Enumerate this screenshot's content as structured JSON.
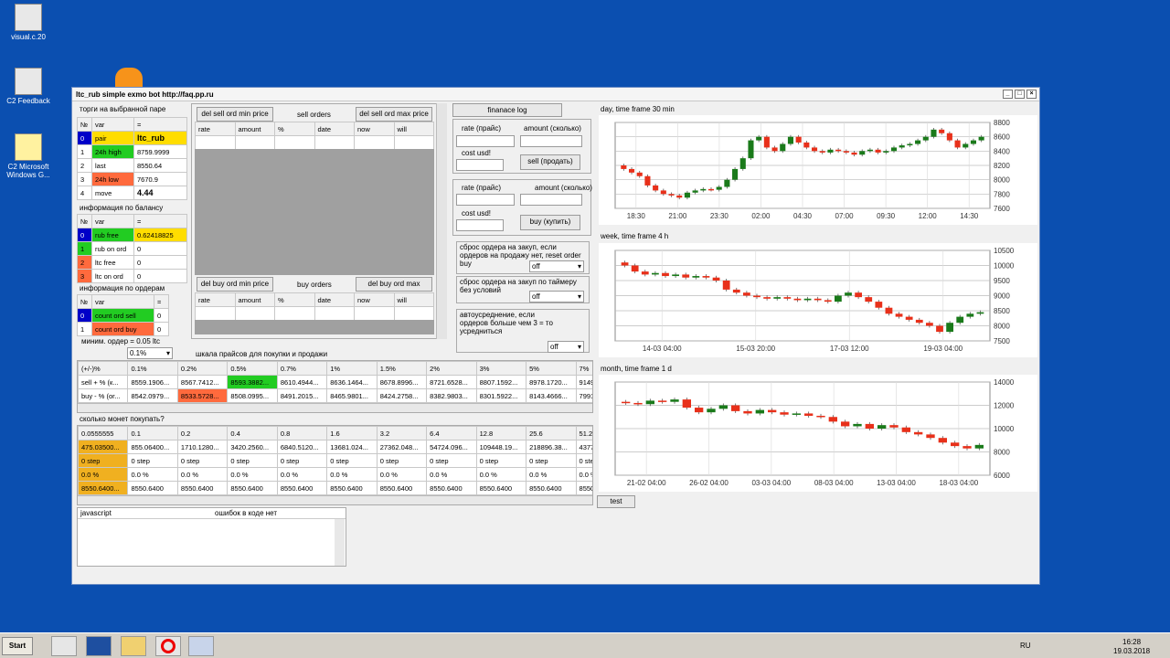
{
  "desktop": {
    "icons": [
      {
        "label": "visual.c.20"
      },
      {
        "label": "C2 Feedback"
      },
      {
        "label": "C2 Microsoft Windows G..."
      }
    ]
  },
  "window": {
    "title": "ltc_rub simple exmo bot http://faq.pp.ru",
    "controls": [
      "_",
      "□",
      "×"
    ]
  },
  "pair_section": {
    "title": "торги на выбранной паре",
    "headers": [
      "№",
      "var",
      "="
    ],
    "rows": [
      {
        "n": "0",
        "var": "pair",
        "val": "ltc_rub"
      },
      {
        "n": "1",
        "var": "24h high",
        "val": "8759.9999"
      },
      {
        "n": "2",
        "var": "last",
        "val": "8550.64"
      },
      {
        "n": "3",
        "var": "24h low",
        "val": "7670.9"
      },
      {
        "n": "4",
        "var": "move",
        "val": "4.44"
      }
    ]
  },
  "balance_section": {
    "title": "информация по балансу",
    "headers": [
      "№",
      "var",
      "="
    ],
    "rows": [
      {
        "n": "0",
        "var": "rub free",
        "val": "0.62418825"
      },
      {
        "n": "1",
        "var": "rub on ord",
        "val": "0"
      },
      {
        "n": "2",
        "var": "ltc free",
        "val": "0"
      },
      {
        "n": "3",
        "var": "ltc on ord",
        "val": "0"
      }
    ]
  },
  "orders_section": {
    "title": "информация по ордерам",
    "headers": [
      "№",
      "var",
      "="
    ],
    "rows": [
      {
        "n": "0",
        "var": "count ord sell",
        "val": "0"
      },
      {
        "n": "1",
        "var": "count ord buy",
        "val": "0"
      }
    ]
  },
  "min_order": {
    "label": "миним. ордер = 0.05 ltc",
    "value": "0.1%"
  },
  "sell_orders": {
    "btn_min": "del sell ord min price",
    "title": "sell orders",
    "btn_max": "del sell ord max price",
    "headers": [
      "rate",
      "amount",
      "%",
      "date",
      "now",
      "will"
    ]
  },
  "buy_orders": {
    "btn_min": "del buy ord min price",
    "title": "buy orders",
    "btn_max": "del buy ord max",
    "headers": [
      "rate",
      "amount",
      "%",
      "date",
      "now",
      "will"
    ]
  },
  "right_controls": {
    "finance_log": "finanace log",
    "sell_rate_label": "rate (прайс)",
    "sell_amount_label": "amount (сколько)",
    "sell_cost_label": "cost usd!",
    "sell_button": "sell (продать)",
    "buy_rate_label": "rate (прайс)",
    "buy_amount_label": "amount (сколько)",
    "buy_cost_label": "cost usd!",
    "buy_button": "buy (купить)",
    "reset_label": "сброс ордера на закуп, если ордеров на продажу нет, reset order buy",
    "reset_value": "off",
    "timer_label": "сброс ордера на закуп по таймеру без условий",
    "timer_value": "off",
    "avg_label": "автоусреднение, если ордеров больше чем 3 = то усредниться",
    "avg_value": "off"
  },
  "price_scale": {
    "title": "шкала прайсов для покупки и продажи",
    "headers": [
      "(+/-)%",
      "0.1%",
      "0.2%",
      "0.5%",
      "0.7%",
      "1%",
      "1.5%",
      "2%",
      "3%",
      "5%",
      "7%"
    ],
    "rows": [
      [
        "sell + % (к...",
        "8559.1906...",
        "8567.7412...",
        "8593.3882...",
        "8610.4944...",
        "8636.1464...",
        "8678.8996...",
        "8721.6528...",
        "8807.1592...",
        "8978.1720...",
        "9149..."
      ],
      [
        "buy - % (or...",
        "8542.0979...",
        "8533.5728...",
        "8508.0995...",
        "8491.2015...",
        "8465.9801...",
        "8424.2758...",
        "8382.9803...",
        "8301.5922...",
        "8143.4666...",
        "7991.2..."
      ]
    ]
  },
  "coins_table": {
    "title": "сколько монет покупать?",
    "headers": [
      "0.0555555",
      "0.1",
      "0.2",
      "0.4",
      "0.8",
      "1.6",
      "3.2",
      "6.4",
      "12.8",
      "25.6",
      "51.2"
    ],
    "rows": [
      [
        "475.03500...",
        "855.06400...",
        "1710.1280...",
        "3420.2560...",
        "6840.5120...",
        "13681.024...",
        "27362.048...",
        "54724.096...",
        "109448.19...",
        "218896.38...",
        "43779..."
      ],
      [
        "0 step",
        "0 step",
        "0 step",
        "0 step",
        "0 step",
        "0 step",
        "0 step",
        "0 step",
        "0 step",
        "0 step",
        "0 step"
      ],
      [
        "0.0 %",
        "0.0 %",
        "0.0 %",
        "0.0 %",
        "0.0 %",
        "0.0 %",
        "0.0 %",
        "0.0 %",
        "0.0 %",
        "0.0 %",
        "0.0 %"
      ],
      [
        "8550.6400...",
        "8550.6400",
        "8550.6400",
        "8550.6400",
        "8550.6400",
        "8550.6400",
        "8550.6400",
        "8550.6400",
        "8550.6400",
        "8550.6400",
        "8550.6..."
      ]
    ]
  },
  "js_panel": {
    "tab1": "javascript",
    "tab2": "ошибок в коде нет"
  },
  "test_button": "test",
  "chart_data": [
    {
      "type": "candlestick",
      "title": "day, time frame 30 min",
      "x_ticks": [
        "18:30",
        "21:00",
        "23:30",
        "02:00",
        "04:30",
        "07:00",
        "09:30",
        "12:00",
        "14:30"
      ],
      "y_ticks": [
        7600,
        7800,
        8000,
        8200,
        8400,
        8600,
        8800
      ],
      "ylim": [
        7600,
        8800
      ],
      "close": [
        8150,
        8100,
        8050,
        7920,
        7850,
        7800,
        7780,
        7750,
        7820,
        7850,
        7870,
        7860,
        7900,
        8000,
        8150,
        8300,
        8550,
        8600,
        8450,
        8400,
        8500,
        8600,
        8520,
        8450,
        8400,
        8380,
        8420,
        8400,
        8380,
        8350,
        8400,
        8420,
        8380,
        8400,
        8450,
        8480,
        8500,
        8550,
        8600,
        8700,
        8650,
        8550,
        8450,
        8500,
        8550,
        8600
      ]
    },
    {
      "type": "candlestick",
      "title": "week, time frame 4 h",
      "x_ticks": [
        "14-03 04:00",
        "15-03 20:00",
        "17-03 12:00",
        "19-03 04:00"
      ],
      "y_ticks": [
        7500,
        8000,
        8500,
        9000,
        9500,
        10000,
        10500
      ],
      "ylim": [
        7500,
        10500
      ],
      "close": [
        10000,
        9800,
        9700,
        9750,
        9650,
        9700,
        9600,
        9650,
        9600,
        9500,
        9200,
        9100,
        9000,
        8950,
        8900,
        8950,
        8900,
        8850,
        8900,
        8850,
        8800,
        9000,
        9100,
        8950,
        8800,
        8600,
        8400,
        8300,
        8200,
        8100,
        8000,
        7800,
        8100,
        8300,
        8400,
        8450
      ]
    },
    {
      "type": "candlestick",
      "title": "month, time frame 1 d",
      "x_ticks": [
        "21-02 04:00",
        "26-02 04:00",
        "03-03 04:00",
        "08-03 04:00",
        "13-03 04:00",
        "18-03 04:00"
      ],
      "y_ticks": [
        6000,
        8000,
        10000,
        12000,
        14000
      ],
      "ylim": [
        6000,
        14000
      ],
      "close": [
        12200,
        12100,
        12400,
        12300,
        12500,
        11800,
        11400,
        11700,
        12000,
        11500,
        11300,
        11600,
        11400,
        11200,
        11300,
        11100,
        11000,
        10600,
        10200,
        10400,
        10000,
        10300,
        10100,
        9700,
        9500,
        9200,
        8800,
        8500,
        8300,
        8600
      ]
    }
  ],
  "taskbar": {
    "start": "Start",
    "lang": "RU",
    "time": "16:28",
    "date": "19.03.2018"
  }
}
